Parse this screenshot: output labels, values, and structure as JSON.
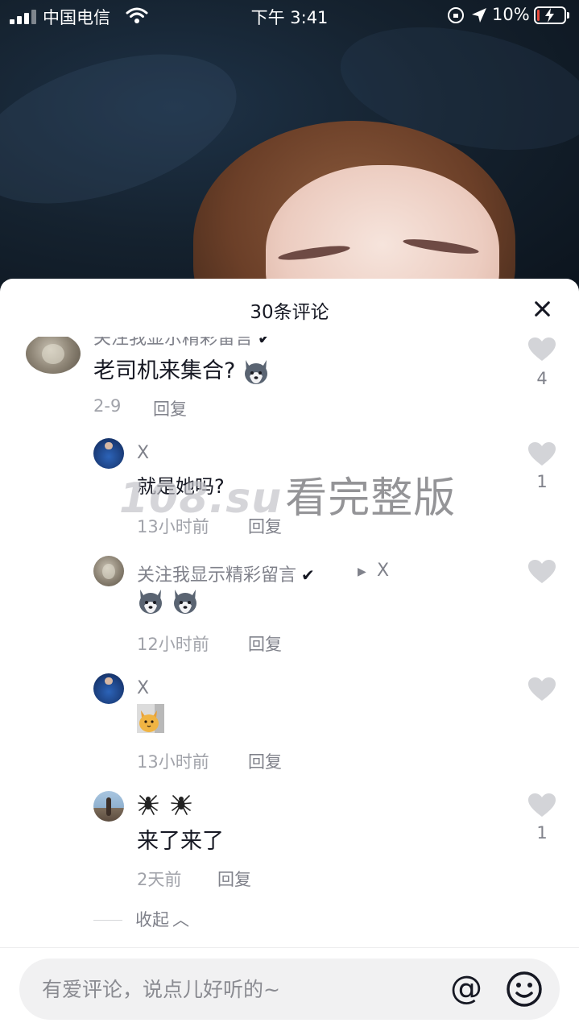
{
  "status_bar": {
    "carrier": "中国电信",
    "time": "下午 3:41",
    "battery": "10%",
    "battery_level": 0.1
  },
  "comments_panel": {
    "title": "30条评论",
    "comments": [
      {
        "username": "关注我显示精彩留言",
        "text": "老司机来集合?",
        "emoji": "husky-emoji",
        "time": "2-9",
        "reply_label": "回复",
        "likes": "4"
      }
    ],
    "replies": [
      {
        "username": "X",
        "text": "就是她吗?",
        "time": "13小时前",
        "reply_label": "回复",
        "likes": "1"
      },
      {
        "username": "关注我显示精彩留言",
        "reply_to": "X",
        "emoji": "husky-emoji x2",
        "time": "12小时前",
        "reply_label": "回复",
        "likes": ""
      },
      {
        "username": "X",
        "emoji": "cat-emoji",
        "time": "13小时前",
        "reply_label": "回复",
        "likes": ""
      },
      {
        "username": "",
        "username_emoji": "spider-emoji x2",
        "text": "来了来了",
        "time": "2天前",
        "reply_label": "回复",
        "likes": "1"
      }
    ],
    "collapse_label": "收起"
  },
  "watermark": {
    "domain": "108.su",
    "text": "看完整版"
  },
  "input_bar": {
    "placeholder": "有爱评论，说点儿好听的~",
    "mention_symbol": "@"
  },
  "colors": {
    "text_primary": "#161823",
    "text_secondary": "#80828b",
    "heart_gray": "#d3d4d8",
    "battery_low": "#e84b3c"
  }
}
